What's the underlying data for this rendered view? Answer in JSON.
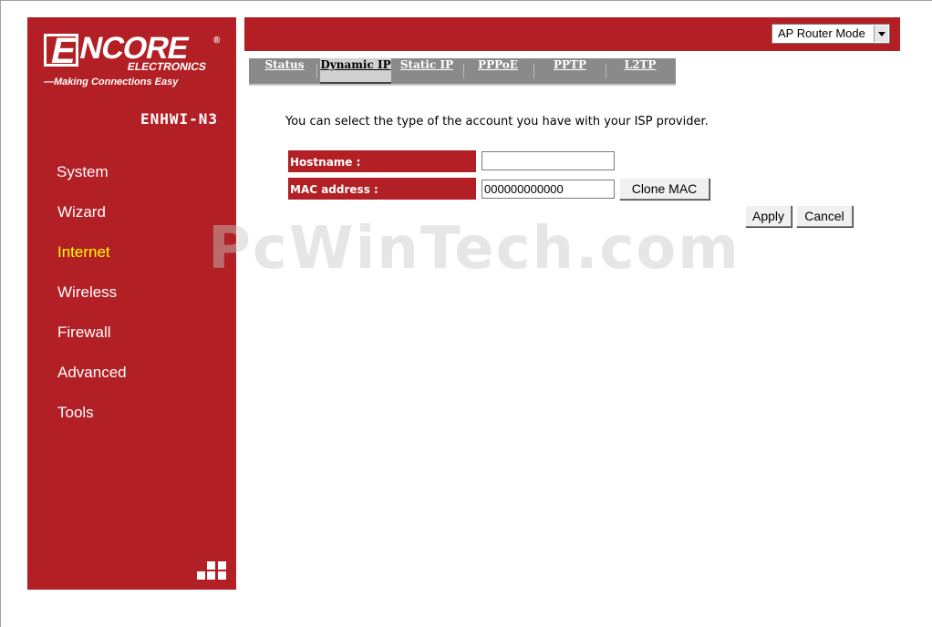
{
  "brand": {
    "logo_letter": "E",
    "logo_word": "NCORE",
    "logo_reg": "®",
    "logo_sub": "ELECTRONICS",
    "tagline": "—Making Connections Easy",
    "model": "ENHWI-N3"
  },
  "sidebar": {
    "items": [
      {
        "label": "System",
        "active": false
      },
      {
        "label": "Wizard",
        "active": false
      },
      {
        "label": "Internet",
        "active": true
      },
      {
        "label": "Wireless",
        "active": false
      },
      {
        "label": "Firewall",
        "active": false
      },
      {
        "label": "Advanced",
        "active": false
      },
      {
        "label": "Tools",
        "active": false
      }
    ]
  },
  "header": {
    "mode_select": "AP Router Mode"
  },
  "tabs": [
    {
      "label": "Status",
      "active": false
    },
    {
      "label": "Dynamic IP",
      "active": true
    },
    {
      "label": "Static IP",
      "active": false
    },
    {
      "label": "PPPoE",
      "active": false
    },
    {
      "label": "PPTP",
      "active": false
    },
    {
      "label": "L2TP",
      "active": false
    }
  ],
  "main": {
    "intro": "You can select the type of the account you have with your ISP provider.",
    "hostname": {
      "label": "Hostname :",
      "value": ""
    },
    "mac": {
      "label": "MAC address :",
      "value": "000000000000"
    },
    "clone_mac_label": "Clone MAC",
    "apply_label": "Apply",
    "cancel_label": "Cancel"
  },
  "watermark": "PcWinTech.com",
  "colors": {
    "brand_red": "#b21f24",
    "active_menu": "#ffff00",
    "tab_gray": "#8a8a8a"
  }
}
